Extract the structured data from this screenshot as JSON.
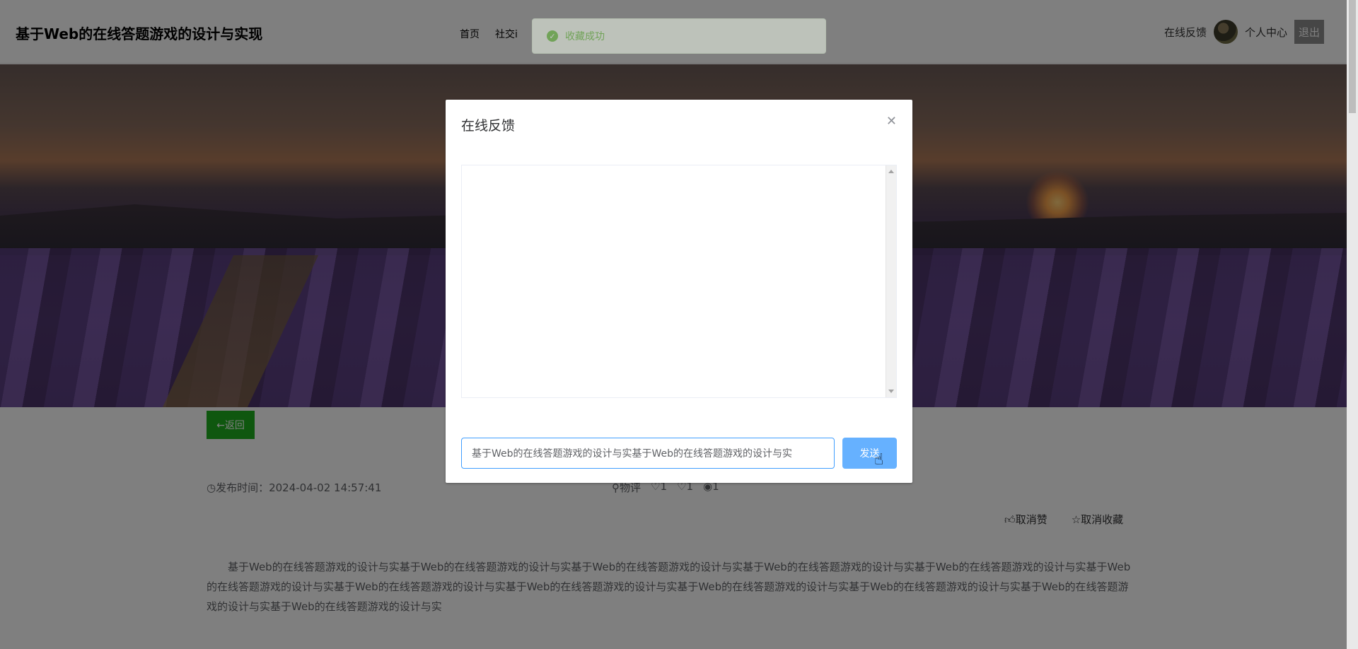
{
  "header": {
    "site_title": "基于Web的在线答题游戏的设计与实现",
    "nav": [
      "首页",
      "社交i"
    ],
    "feedback_label": "在线反馈",
    "personal_center": "个人中心",
    "logout": "退出"
  },
  "toast": {
    "message": "收藏成功",
    "icon": "check-circle-icon"
  },
  "content": {
    "back_label": "←返回",
    "publish_time": "◷发布时间：2024-04-02 14:57:41",
    "stats": [
      "⚲物评",
      "♡1",
      "♡1",
      "◉1"
    ],
    "unlike_label": "取消赞",
    "unfavorite_label": "取消收藏",
    "article_text": "基于Web的在线答题游戏的设计与实基于Web的在线答题游戏的设计与实基于Web的在线答题游戏的设计与实基于Web的在线答题游戏的设计与实基于Web的在线答题游戏的设计与实基于Web的在线答题游戏的设计与实基于Web的在线答题游戏的设计与实基于Web的在线答题游戏的设计与实基于Web的在线答题游戏的设计与实基于Web的在线答题游戏的设计与实基于Web的在线答题游戏的设计与实基于Web的在线答题游戏的设计与实"
  },
  "modal": {
    "title": "在线反馈",
    "close_icon": "close-icon",
    "input_value": "基于Web的在线答题游戏的设计与实基于Web的在线答题游戏的设计与实",
    "send_label": "发送"
  },
  "colors": {
    "back_button": "#1fae1f",
    "send_button": "#66b1ff",
    "toast_text": "#67c23a",
    "overlay": "rgba(0,0,0,0.5)"
  }
}
